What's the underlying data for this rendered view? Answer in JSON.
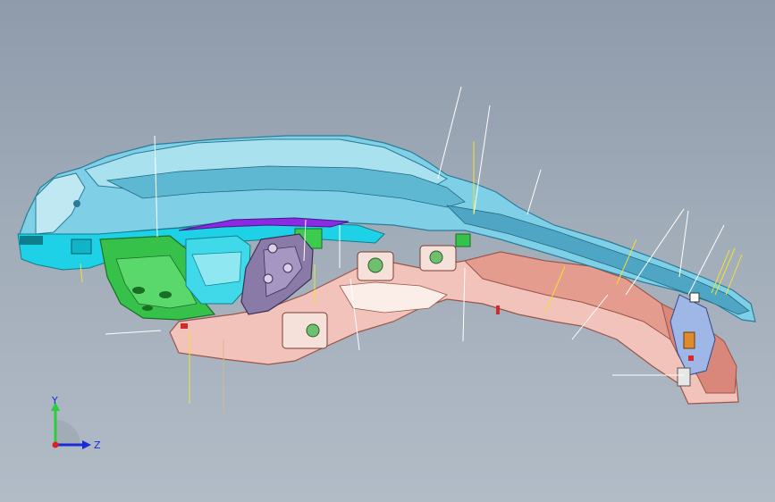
{
  "viewport": {
    "background_top": "#8f9bab",
    "background_bottom": "#b2bcc7"
  },
  "model": {
    "colors": {
      "blue_shell": "#7fd0e6",
      "blue_shell_dark": "#2a7c99",
      "cyan": "#1fd1e6",
      "green": "#36c24a",
      "green_dark": "#1a6e24",
      "pink": "#f1c3bb",
      "pink_dark": "#9a5448",
      "purple": "#8a7aa8",
      "violet": "#8a2be2",
      "white": "#ffffff",
      "yellow": "#f2e230"
    }
  },
  "triad": {
    "y_label": "Y",
    "z_label": "Z",
    "y_color": "#2ecc40",
    "z_color": "#1a2bd8",
    "origin_color": "#e02020"
  }
}
